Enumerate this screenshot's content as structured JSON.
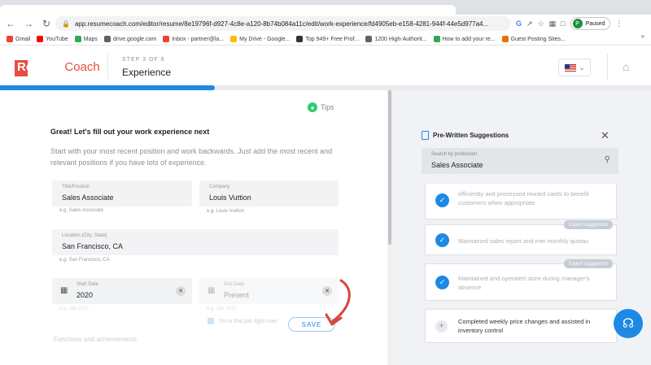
{
  "browser": {
    "url": "app.resumecoach.com/editor/resume/8e19796f-d927-4c8e-a120-8b74b084a11c/edit/work-experience/fd4905eb-e158-4281-944f-44e5d977a4...",
    "profile_status": "Paused",
    "profile_initial": "P",
    "bookmarks": [
      {
        "label": "Gmail",
        "color": "#ea4335"
      },
      {
        "label": "YouTube",
        "color": "#ff0000"
      },
      {
        "label": "Maps",
        "color": "#34a853"
      },
      {
        "label": "drive.google.com",
        "color": "#5f6368"
      },
      {
        "label": "Inbox - partner@la...",
        "color": "#ea4335"
      },
      {
        "label": "My Drive - Google...",
        "color": "#fbbc04"
      },
      {
        "label": "Top 949+ Free Prof...",
        "color": "#333333"
      },
      {
        "label": "1200 High-Authorit...",
        "color": "#5f6368"
      },
      {
        "label": "How to add your re...",
        "color": "#34a853"
      },
      {
        "label": "Guest Posting Sites...",
        "color": "#e8710a"
      }
    ]
  },
  "header": {
    "logo_resume": "Resume",
    "logo_coach": "Coach",
    "step": "STEP 3 OF 6",
    "title": "Experience",
    "progress": 0.33
  },
  "form": {
    "tips": "Tips",
    "intro_title": "Great! Let's fill out your work experience next",
    "intro_text": "Start with your most recent position and work backwards. Just add the most recent and relevant positions if you have lots of experience.",
    "title_label": "Title/Position",
    "title_value": "Sales Associate",
    "title_hint": "e.g. Sales Associate",
    "company_label": "Company",
    "company_value": "Louis Vuttion",
    "company_hint": "e.g. Louis Vuitton",
    "location_label": "Location (City, State)",
    "location_value": "San Francisco, CA",
    "location_hint": "e.g. San Francisco, CA",
    "start_label": "Start Date",
    "start_value": "2020",
    "start_hint": "e.g. Jan 2017",
    "end_label": "End Date",
    "end_value": "Present",
    "end_hint": "e.g. Jan 2017",
    "current_job": "I'm in this job right now",
    "save": "SAVE",
    "functions": "Functions and achievements"
  },
  "panel": {
    "title": "Pre-Written Suggestions",
    "search_label": "Search by profession",
    "search_value": "Sales Associate",
    "cards": [
      {
        "text": "efficiently and processed reward cards to benefit customers when appropriate",
        "badge": "",
        "selected": true
      },
      {
        "text": "Maintained sales report and met monthly quotas",
        "badge": "Expert suggestion",
        "selected": true
      },
      {
        "text": "Maintained and operated store during manager's absence",
        "badge": "Expert suggestion",
        "selected": true
      },
      {
        "text": "Completed weekly price changes and assisted in inventory control",
        "badge": "",
        "selected": false
      }
    ]
  }
}
